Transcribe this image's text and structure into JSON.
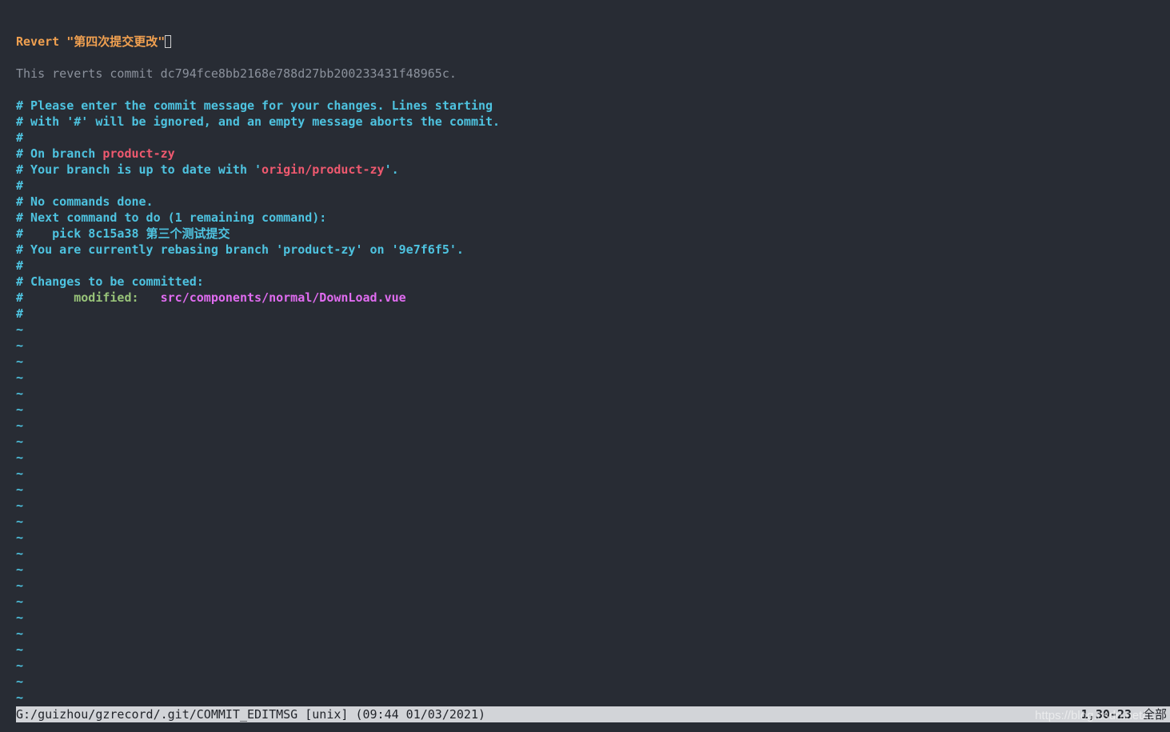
{
  "commit_title": {
    "prefix": "Revert ",
    "message": "\"第四次提交更改\""
  },
  "reverts_line": "This reverts commit dc794fce8bb2168e788d27bb200233431f48965c.",
  "comments": {
    "line1": "# Please enter the commit message for your changes. Lines starting",
    "line2": "# with '#' will be ignored, and an empty message aborts the commit.",
    "hash": "#",
    "on_branch_prefix": "# On branch ",
    "branch": "product-zy",
    "up_to_date_prefix": "# Your branch is up to date with '",
    "remote_branch": "origin/product-zy",
    "up_to_date_suffix": "'.",
    "no_commands": "# No commands done.",
    "next_command": "# Next command to do (1 remaining command):",
    "pick_hash": "#    ",
    "pick_line": "pick 8c15a38 第三个测试提交",
    "rebasing": "# You are currently rebasing branch 'product-zy' on '9e7f6f5'.",
    "changes_header": "# Changes to be committed:",
    "modified_hash": "#       ",
    "modified_label": "modified:",
    "modified_gap": "   ",
    "modified_file": "src/components/normal/DownLoad.vue"
  },
  "tilde_char": "~",
  "tilde_count": 24,
  "statusbar": {
    "file_info": "G:/guizhou/gzrecord/.git/COMMIT_EDITMSG [unix] (09:44 01/03/2021)",
    "position": "1,30-23",
    "scroll": "全部"
  },
  "watermark": "https://blog.csdn.net/..."
}
